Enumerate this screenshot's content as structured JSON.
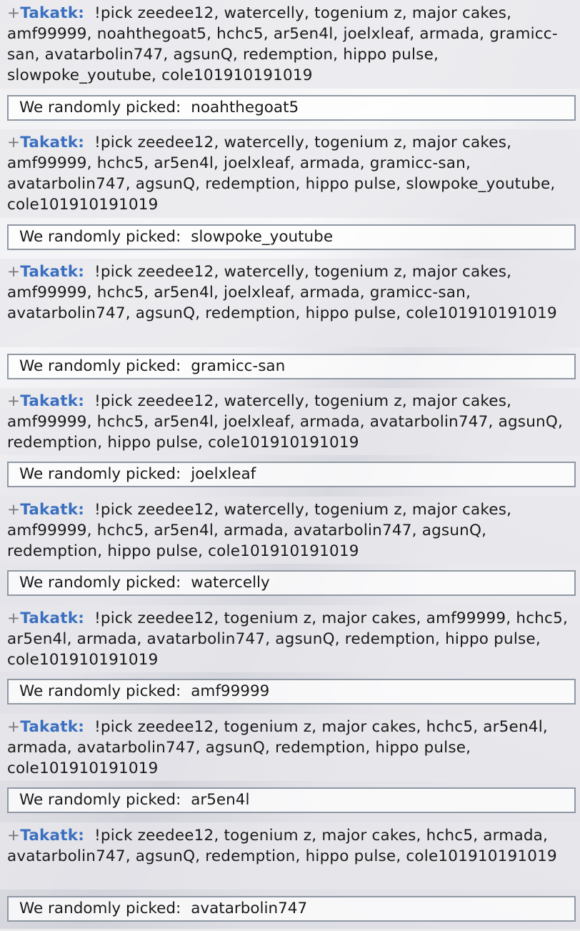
{
  "entries": [
    {
      "user": "Takatk:",
      "rank": "+",
      "message": "!pick zeedee12, watercelly, togenium z, major cakes, amf99999, noahthegoat5, hchc5, ar5en4l, joelxleaf, armada, gramicc-san, avatarbolin747, agsunQ, redemption, hippo pulse, slowpoke_youtube, cole101910191019",
      "notice_label": "We randomly picked:",
      "picked": "noahthegoat5"
    },
    {
      "user": "Takatk:",
      "rank": "+",
      "message": "!pick zeedee12, watercelly, togenium z, major cakes, amf99999, hchc5, ar5en4l, joelxleaf, armada, gramicc-san, avatarbolin747, agsunQ, redemption, hippo pulse, slowpoke_youtube, cole101910191019",
      "notice_label": "We randomly picked:",
      "picked": "slowpoke_youtube"
    },
    {
      "user": "Takatk:",
      "rank": "+",
      "message": "!pick zeedee12, watercelly, togenium z, major cakes, amf99999, hchc5, ar5en4l, joelxleaf, armada, gramicc-san, avatarbolin747, agsunQ, redemption, hippo pulse, cole101910191019",
      "notice_label": "We randomly picked:",
      "picked": "gramicc-san"
    },
    {
      "user": "Takatk:",
      "rank": "+",
      "message": "!pick zeedee12, watercelly, togenium z, major cakes, amf99999, hchc5, ar5en4l, joelxleaf, armada, avatarbolin747, agsunQ, redemption, hippo pulse, cole101910191019",
      "notice_label": "We randomly picked:",
      "picked": "joelxleaf"
    },
    {
      "user": "Takatk:",
      "rank": "+",
      "message": "!pick zeedee12, watercelly, togenium z, major cakes, amf99999, hchc5, ar5en4l, armada, avatarbolin747, agsunQ, redemption, hippo pulse, cole101910191019",
      "notice_label": "We randomly picked:",
      "picked": "watercelly"
    },
    {
      "user": "Takatk:",
      "rank": "+",
      "message": "!pick zeedee12, togenium z, major cakes, amf99999, hchc5, ar5en4l, armada, avatarbolin747, agsunQ, redemption, hippo pulse, cole101910191019",
      "notice_label": "We randomly picked:",
      "picked": "amf99999"
    },
    {
      "user": "Takatk:",
      "rank": "+",
      "message": "!pick zeedee12, togenium z, major cakes, hchc5, ar5en4l, armada, avatarbolin747, agsunQ, redemption, hippo pulse, cole101910191019",
      "notice_label": "We randomly picked:",
      "picked": "ar5en4l"
    },
    {
      "user": "Takatk:",
      "rank": "+",
      "message": "!pick zeedee12, togenium z, major cakes, hchc5, armada, avatarbolin747, agsunQ, redemption, hippo pulse, cole101910191019",
      "notice_label": "We randomly picked:",
      "picked": "avatarbolin747"
    }
  ],
  "colors": {
    "username": "#3a6fc0",
    "rank_symbol": "#7a7a7a",
    "notice_border": "#8f98a3"
  }
}
